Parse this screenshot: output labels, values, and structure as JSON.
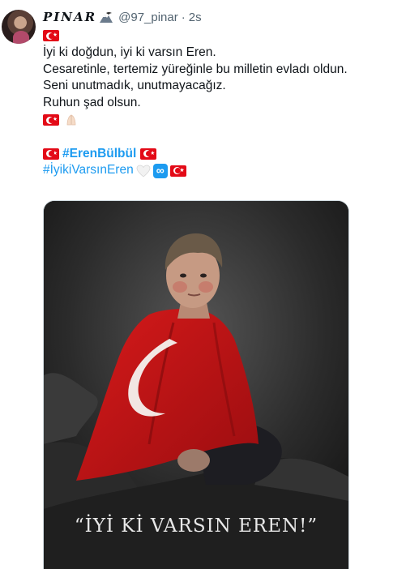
{
  "author": {
    "display_name": "PINAR",
    "handle": "@97_pinar",
    "separator": "·",
    "time": "2s"
  },
  "tweet": {
    "lines": [
      "İyi ki doğdun, iyi ki varsın Eren.",
      "Cesaretinle, tertemiz yüreğinle bu milletin evladı oldun.",
      "Seni unutmadık, unutmayacağız.",
      "Ruhun şad olsun."
    ],
    "hashtag_1": "#ErenBülbül",
    "hashtag_2": "#İyikiVarsınEren"
  },
  "media": {
    "caption": "“İYİ Kİ VARSIN EREN!”"
  },
  "icons": {
    "flag": "turkish-flag-icon",
    "name_emoji": "eagle-mountain-emoji",
    "hands": "folded-hands-icon",
    "heart": "white-heart-icon",
    "infinity": "infinity-icon"
  },
  "colors": {
    "link": "#1d9bf0",
    "secondary_text": "#536471",
    "flag_red": "#e30a17"
  }
}
